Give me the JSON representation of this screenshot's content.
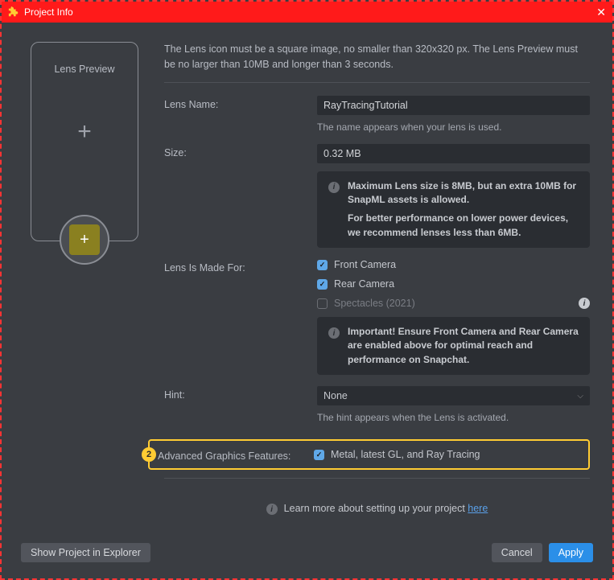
{
  "window": {
    "title": "Project Info"
  },
  "preview": {
    "label": "Lens Preview"
  },
  "description": "The Lens icon must be a square image, no smaller than 320x320 px. The Lens Preview must be no larger than 10MB and longer than 3 seconds.",
  "fields": {
    "lensName": {
      "label": "Lens Name:",
      "value": "RayTracingTutorial",
      "sub": "The name appears when your lens is used."
    },
    "size": {
      "label": "Size:",
      "value": "0.32 MB"
    },
    "sizeInfo": {
      "line1": "Maximum Lens size is 8MB, but an extra 10MB for SnapML assets is allowed.",
      "line2": "For better performance on lower power devices, we recommend lenses less than 6MB."
    },
    "madeFor": {
      "label": "Lens Is Made For:",
      "front": "Front Camera",
      "rear": "Rear Camera",
      "spectacles": "Spectacles (2021)"
    },
    "madeForInfo": "Important! Ensure Front Camera and Rear Camera are enabled above for optimal reach and performance on Snapchat.",
    "hint": {
      "label": "Hint:",
      "value": "None",
      "sub": "The hint appears when the Lens is activated."
    },
    "advanced": {
      "label": "Advanced Graphics Features:",
      "option": "Metal, latest GL, and Ray Tracing",
      "badge": "2"
    }
  },
  "learn": {
    "text": "Learn more about setting up your project ",
    "link": "here"
  },
  "footer": {
    "show": "Show Project in Explorer",
    "cancel": "Cancel",
    "apply": "Apply"
  }
}
